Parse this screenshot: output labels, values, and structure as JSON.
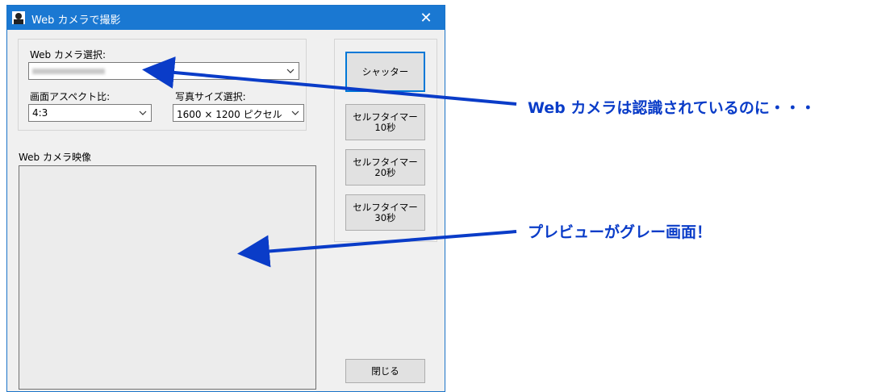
{
  "window": {
    "title": "Web カメラで撮影",
    "close_symbol": "✕",
    "icon": "camera-user-icon"
  },
  "settings": {
    "camera_label": "Web カメラ選択:",
    "camera_value_blurred": "",
    "aspect_label": "画面アスペクト比:",
    "aspect_value": "4:3",
    "photo_size_label": "写真サイズ選択:",
    "photo_size_value": "1600 × 1200 ピクセル"
  },
  "preview": {
    "label": "Web カメラ映像"
  },
  "buttons": {
    "shutter": "シャッター",
    "timer10": "セルフタイマー\n10秒",
    "timer20": "セルフタイマー\n20秒",
    "timer30": "セルフタイマー\n30秒",
    "close": "閉じる"
  },
  "annotations": {
    "camera_note": "Web カメラは認識されているのに・・・",
    "preview_note": "プレビューがグレー画面！",
    "color": "#0a3cc8"
  }
}
